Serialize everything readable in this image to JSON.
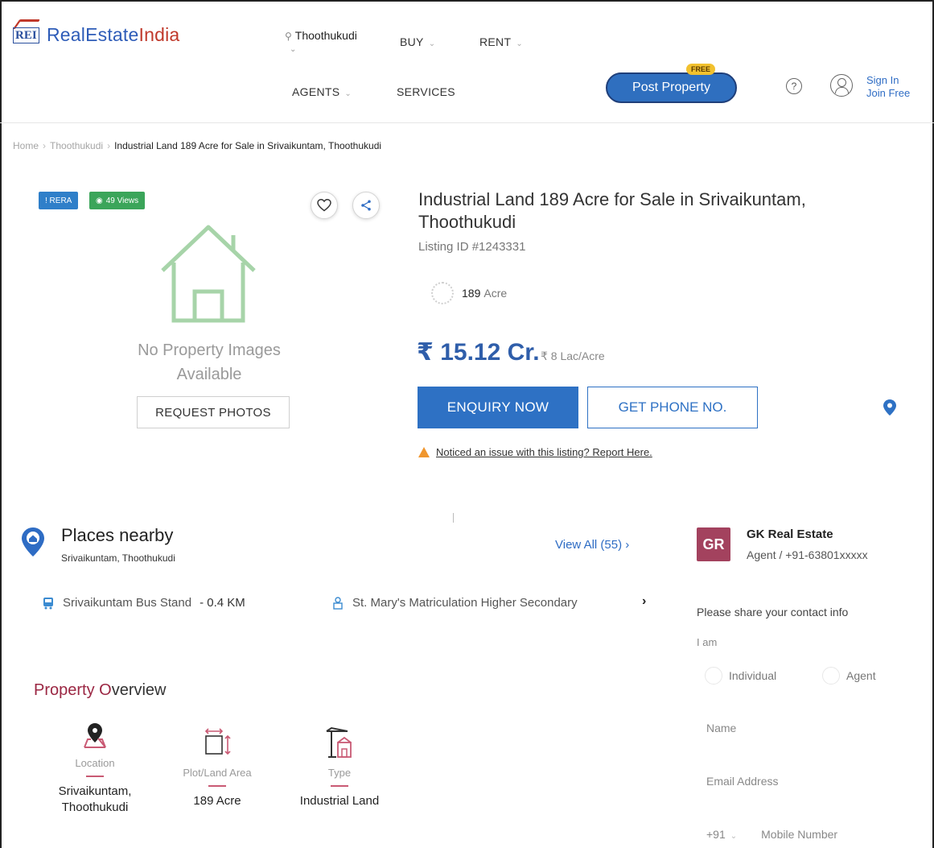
{
  "header": {
    "logo_code": "REI",
    "logo_text_1": "RealEstate",
    "logo_text_2": "India",
    "city": "Thoothukudi",
    "nav": {
      "buy": "BUY",
      "rent": "RENT",
      "agents": "AGENTS",
      "services": "SERVICES"
    },
    "post_property": "Post Property",
    "free_badge": "FREE",
    "sign_in": "Sign In",
    "join_free": "Join Free"
  },
  "breadcrumb": {
    "home": "Home",
    "city": "Thoothukudi",
    "current": "Industrial Land 189 Acre for Sale in Srivaikuntam, Thoothukudi"
  },
  "listing": {
    "rera_badge": "! RERA",
    "views_badge": "49 Views",
    "no_images_1": "No Property Images",
    "no_images_2": "Available",
    "request_photos": "REQUEST PHOTOS",
    "title": "Industrial Land 189 Acre for Sale in Srivaikuntam, Thoothukudi",
    "listing_id": "Listing ID #1243331",
    "area_value": "189",
    "area_unit": "Acre",
    "price": "₹ 15.12 Cr.",
    "price_per_unit": "₹ 8 Lac/Acre",
    "enquiry_button": "ENQUIRY NOW",
    "phone_button": "GET PHONE NO.",
    "report_text": "Noticed an issue with this listing? Report Here."
  },
  "places": {
    "title": "Places nearby",
    "subtitle": "Srivaikuntam, Thoothukudi",
    "view_all": "View All (55) ›",
    "items": [
      {
        "name": "Srivaikuntam Bus Stand",
        "distance": "- 0.4 KM",
        "icon": "bus-icon"
      },
      {
        "name": "St. Mary's Matriculation Higher Secondary",
        "distance": "",
        "icon": "school-icon"
      }
    ],
    "next": "›"
  },
  "overview": {
    "title_first": "Property O",
    "title_rest": "verview",
    "items": [
      {
        "label": "Location",
        "value_1": "Srivaikuntam,",
        "value_2": "Thoothukudi",
        "icon": "location-pin-icon"
      },
      {
        "label": "Plot/Land Area",
        "value_1": "189 Acre",
        "value_2": "",
        "icon": "area-icon"
      },
      {
        "label": "Type",
        "value_1": "Industrial Land",
        "value_2": "",
        "icon": "industrial-icon"
      }
    ]
  },
  "agent": {
    "initials": "GR",
    "name": "GK Real Estate",
    "subtitle": "Agent / +91-63801xxxxx",
    "prompt": "Please share your contact info",
    "i_am": "I am",
    "individual": "Individual",
    "agent_option": "Agent",
    "name_placeholder": "Name",
    "email_placeholder": "Email Address",
    "country_code": "+91",
    "mobile_placeholder": "Mobile Number"
  },
  "colors": {
    "brand_blue": "#2e71c4",
    "brand_red": "#c0392b",
    "rera_blue": "#2f7fc9",
    "views_green": "#3ba55a",
    "agent_avatar": "#a3425e",
    "free_yellow": "#f2c12e"
  }
}
